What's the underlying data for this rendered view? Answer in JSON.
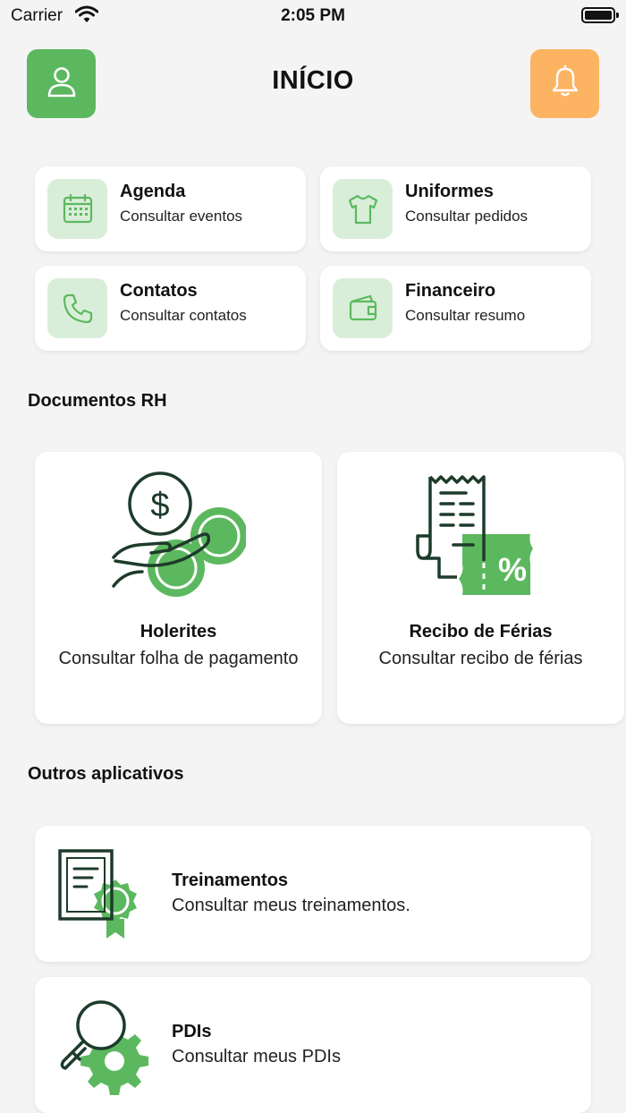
{
  "status_bar": {
    "carrier": "Carrier",
    "time": "2:05 PM"
  },
  "header": {
    "title": "INÍCIO"
  },
  "quick_actions": [
    {
      "title": "Agenda",
      "subtitle": "Consultar eventos",
      "icon": "calendar-icon"
    },
    {
      "title": "Uniformes",
      "subtitle": "Consultar pedidos",
      "icon": "shirt-icon"
    },
    {
      "title": "Contatos",
      "subtitle": "Consultar contatos",
      "icon": "phone-icon"
    },
    {
      "title": "Financeiro",
      "subtitle": "Consultar resumo",
      "icon": "wallet-icon"
    }
  ],
  "documents": {
    "label": "Documentos RH",
    "items": [
      {
        "title": "Holerites",
        "subtitle": "Consultar folha de pagamento",
        "icon": "money-hand-icon"
      },
      {
        "title": "Recibo de Férias",
        "subtitle": "Consultar recibo de férias",
        "icon": "receipt-percent-icon"
      }
    ]
  },
  "other_apps": {
    "label": "Outros aplicativos",
    "items": [
      {
        "title": "Treinamentos",
        "subtitle": "Consultar meus treinamentos.",
        "icon": "certificate-icon"
      },
      {
        "title": "PDIs",
        "subtitle": "Consultar meus PDIs",
        "icon": "search-gear-icon"
      }
    ]
  },
  "colors": {
    "green": "#5cb85f",
    "light_green": "#d9eed9",
    "orange": "#fcb462",
    "dark_green": "#1d3b2a"
  }
}
